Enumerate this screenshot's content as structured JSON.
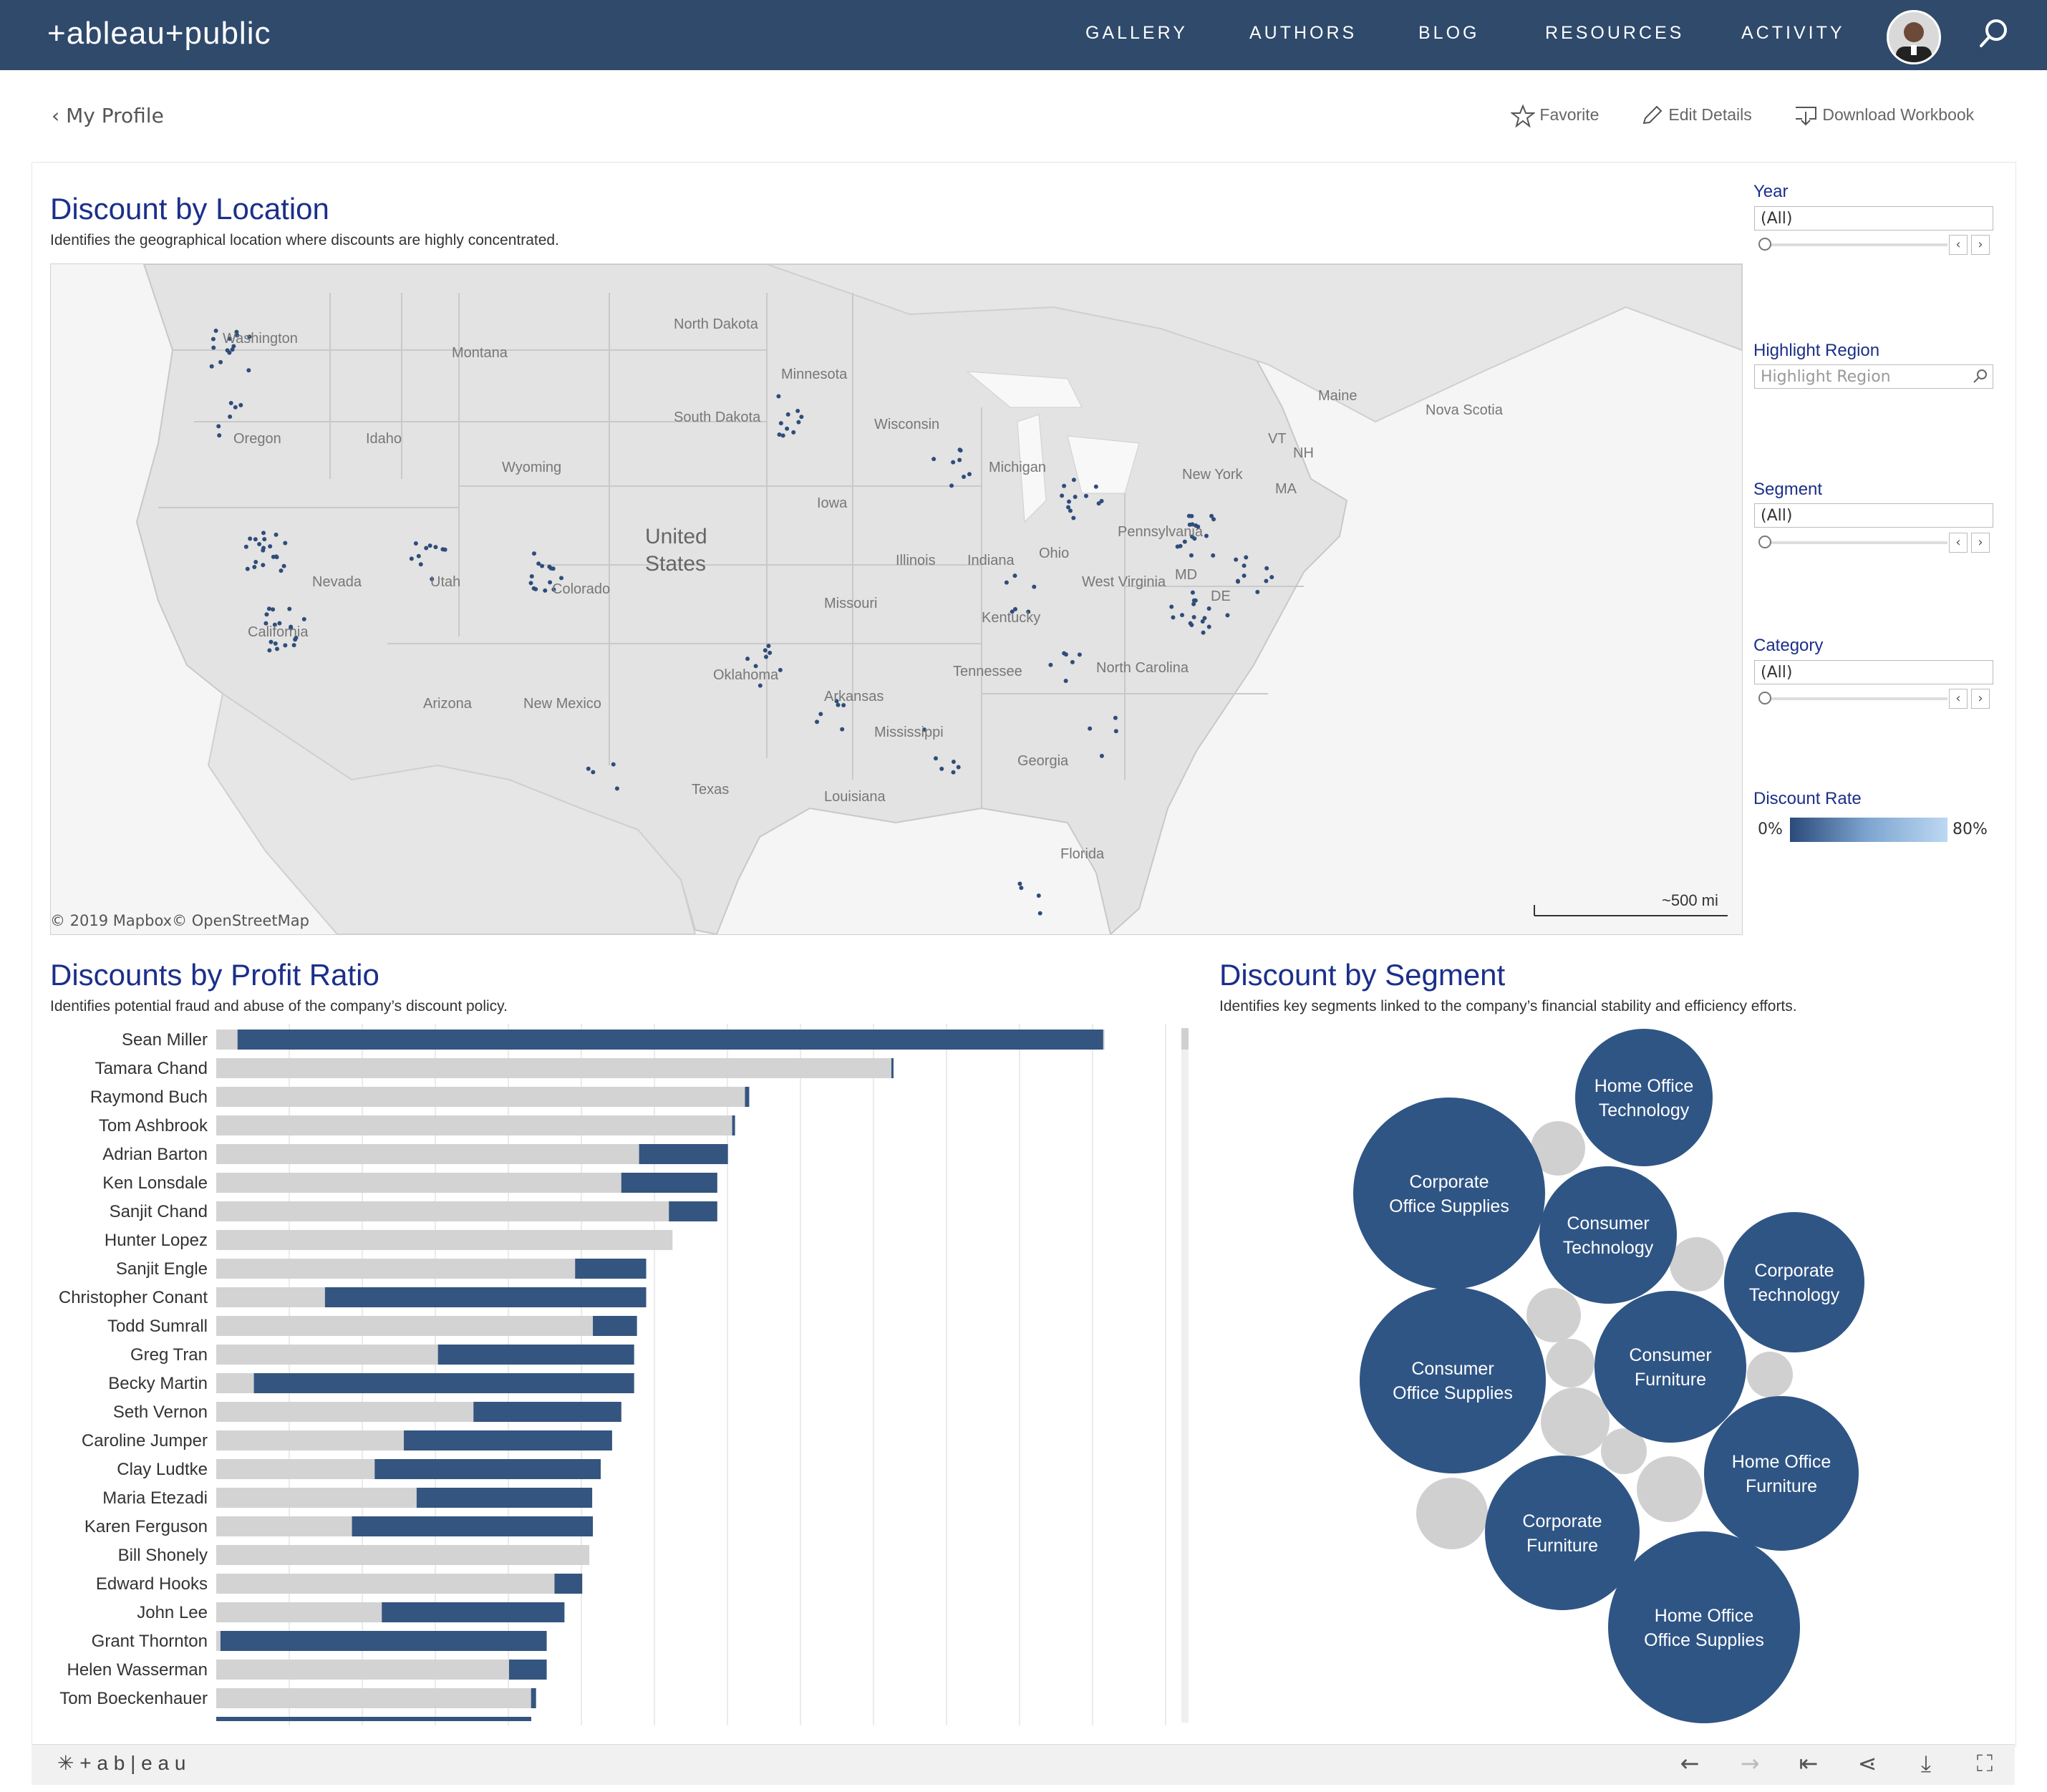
{
  "nav": {
    "logo": "+ableau+public",
    "items": [
      "GALLERY",
      "AUTHORS",
      "BLOG",
      "RESOURCES",
      "ACTIVITY"
    ]
  },
  "profile": {
    "back_label": "My Profile",
    "actions": [
      "Favorite",
      "Edit Details",
      "Download Workbook"
    ]
  },
  "map_section": {
    "title": "Discount by Location",
    "subtitle": "Identifies the geographical location where discounts are highly concentrated.",
    "credit": "© 2019 Mapbox© OpenStreetMap",
    "scale": "~500 mi",
    "labels": {
      "country": [
        "United",
        "States"
      ],
      "regions": [
        "Washington",
        "Montana",
        "North Dakota",
        "South Dakota",
        "Minnesota",
        "Wisconsin",
        "Michigan",
        "Maine",
        "Nova Scotia",
        "New York",
        "Pennsylvania",
        "Ohio",
        "Illinois",
        "Indiana",
        "Iowa",
        "Missouri",
        "Kentucky",
        "West Virginia",
        "Oregon",
        "Idaho",
        "Wyoming",
        "Nevada",
        "Utah",
        "Colorado",
        "California",
        "Arizona",
        "New Mexico",
        "Oklahoma",
        "Arkansas",
        "Mississippi",
        "Tennessee",
        "North Carolina",
        "Georgia",
        "Texas",
        "Louisiana",
        "Florida",
        "VT",
        "NH",
        "MA",
        "MD",
        "DE"
      ]
    }
  },
  "filters": {
    "year": {
      "label": "Year",
      "value": "(All)"
    },
    "highlight_region": {
      "label": "Highlight Region",
      "placeholder": "Highlight Region"
    },
    "segment": {
      "label": "Segment",
      "value": "(All)"
    },
    "category": {
      "label": "Category",
      "value": "(All)"
    },
    "discount_rate": {
      "label": "Discount Rate",
      "min": "0%",
      "max": "80%"
    }
  },
  "bar_section": {
    "title": "Discounts by Profit Ratio",
    "subtitle": "Identifies potential fraud and abuse of the company’s discount policy."
  },
  "segment_section": {
    "title": "Discount by Segment",
    "subtitle": "Identifies key segments linked to the company’s financial stability and efficiency efforts."
  },
  "chart_data": [
    {
      "type": "bar",
      "title": "Discounts by Profit Ratio",
      "categories": [
        "Sean Miller",
        "Tamara Chand",
        "Raymond Buch",
        "Tom Ashbrook",
        "Adrian Barton",
        "Ken Lonsdale",
        "Sanjit Chand",
        "Hunter Lopez",
        "Sanjit Engle",
        "Christopher Conant",
        "Todd Sumrall",
        "Greg Tran",
        "Becky Martin",
        "Seth Vernon",
        "Caroline Jumper",
        "Clay Ludtke",
        "Maria Etezadi",
        "Karen Ferguson",
        "Bill Shonely",
        "Edward Hooks",
        "John Lee",
        "Grant Thornton",
        "Helen Wasserman",
        "Tom Boeckenhauer"
      ],
      "series": [
        {
          "values": [
            1250,
            950,
            750,
            730,
            720,
            705,
            705,
            642,
            605,
            605,
            592,
            588,
            588,
            570,
            557,
            541,
            529,
            530,
            525,
            515,
            490,
            465,
            465,
            450
          ]
        },
        {
          "values": [
            1218,
            3,
            6,
            4,
            125,
            135,
            68,
            0,
            100,
            452,
            62,
            276,
            535,
            208,
            293,
            318,
            247,
            339,
            0,
            39,
            257,
            459,
            53,
            7
          ]
        }
      ],
      "series_start": [
        30,
        950,
        744,
        726,
        595,
        570,
        637,
        642,
        505,
        153,
        530,
        312,
        53,
        362,
        264,
        223,
        282,
        191,
        525,
        476,
        233,
        6,
        412,
        443
      ]
    },
    {
      "type": "bubble",
      "title": "Discount by Segment",
      "categories": [
        "Corporate Office Supplies",
        "Consumer Office Supplies",
        "Home Office Office Supplies",
        "Home Office Technology",
        "Consumer Technology",
        "Corporate Technology",
        "Consumer Furniture",
        "Home Office Furniture",
        "Corporate Furniture"
      ]
    }
  ],
  "bubble_labels": [
    [
      "Home Office",
      "Technology"
    ],
    [
      "Corporate",
      "Office Supplies"
    ],
    [
      "Consumer",
      "Technology"
    ],
    [
      "Corporate",
      "Technology"
    ],
    [
      "Consumer",
      "Office Supplies"
    ],
    [
      "Consumer",
      "Furniture"
    ],
    [
      "Home Office",
      "Furniture"
    ],
    [
      "Corporate",
      "Furniture"
    ],
    [
      "Home Office",
      "Office Supplies"
    ]
  ],
  "bottom_bar": {
    "brand": "+ a b | e a u"
  },
  "colors": {
    "header": "#2f4a6b",
    "bar_dark": "#34557f",
    "bar_light": "#d3d3d3",
    "bubble": "#2f5585",
    "bubble_grey": "#d0d0d0",
    "title": "#1b2f8a"
  }
}
